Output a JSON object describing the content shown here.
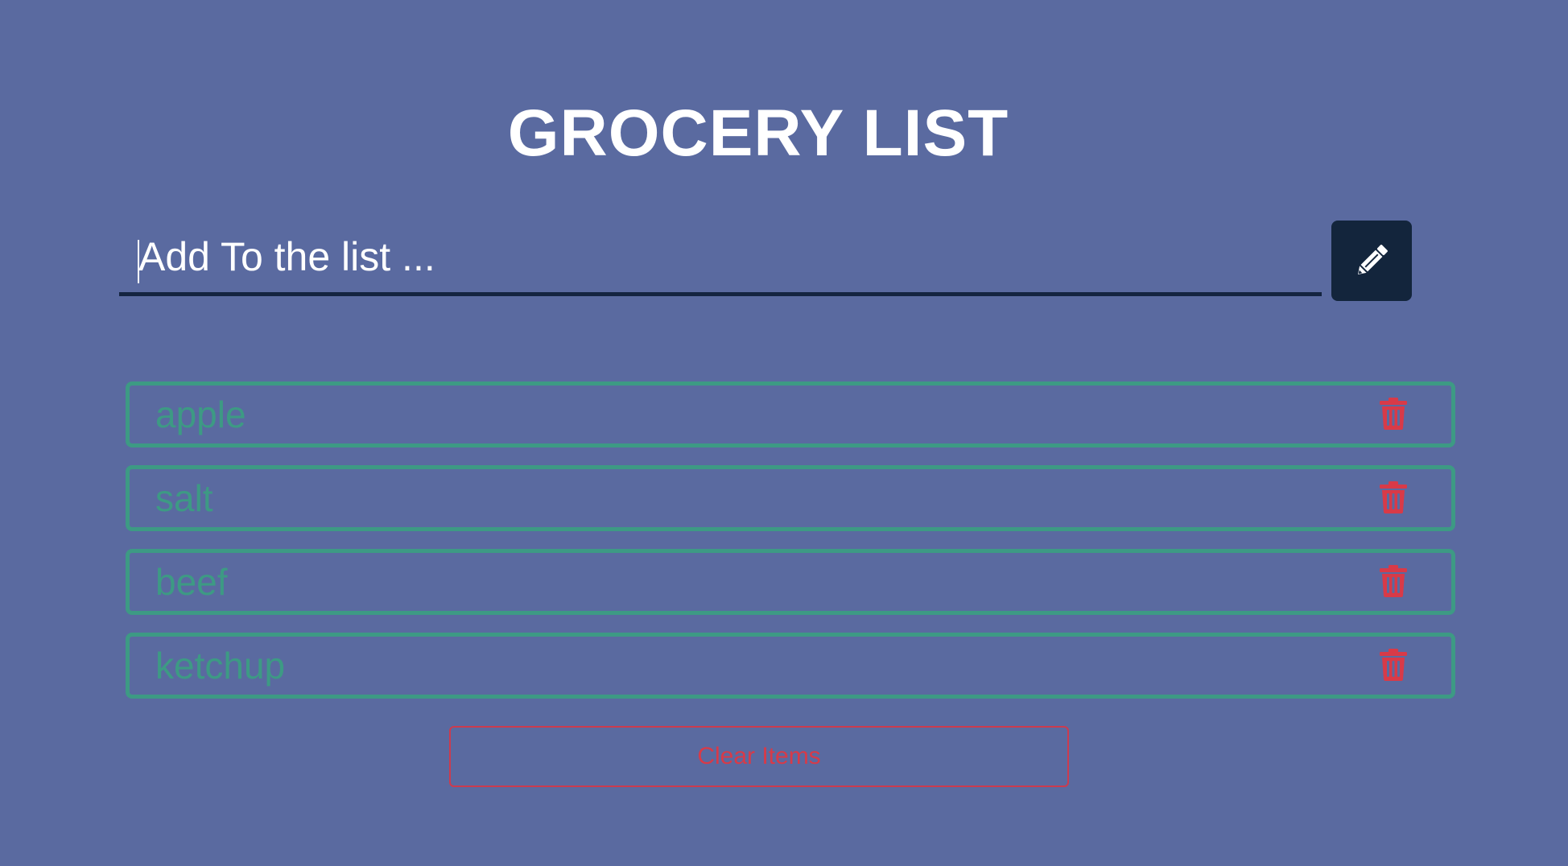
{
  "header": {
    "title": "GROCERY LIST"
  },
  "add_form": {
    "placeholder": "Add To the list ...",
    "value": "",
    "button_icon": "pencil-icon"
  },
  "items": [
    {
      "name": "apple",
      "delete_icon": "trash-icon"
    },
    {
      "name": "salt",
      "delete_icon": "trash-icon"
    },
    {
      "name": "beef",
      "delete_icon": "trash-icon"
    },
    {
      "name": "ketchup",
      "delete_icon": "trash-icon"
    }
  ],
  "clear_button": {
    "label": "Clear Items"
  },
  "colors": {
    "background": "#5a6aa0",
    "button_dark": "#13253c",
    "item_green": "#3d9a84",
    "danger_red": "#d83a48",
    "text_white": "#ffffff"
  }
}
